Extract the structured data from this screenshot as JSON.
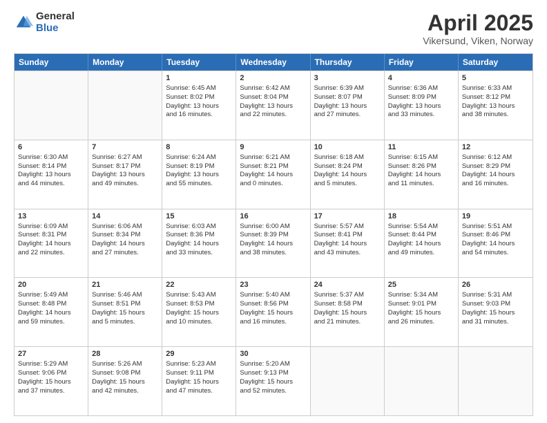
{
  "logo": {
    "general": "General",
    "blue": "Blue"
  },
  "title": "April 2025",
  "subtitle": "Vikersund, Viken, Norway",
  "weekdays": [
    "Sunday",
    "Monday",
    "Tuesday",
    "Wednesday",
    "Thursday",
    "Friday",
    "Saturday"
  ],
  "weeks": [
    [
      {
        "day": "",
        "info": ""
      },
      {
        "day": "",
        "info": ""
      },
      {
        "day": "1",
        "info": "Sunrise: 6:45 AM\nSunset: 8:02 PM\nDaylight: 13 hours\nand 16 minutes."
      },
      {
        "day": "2",
        "info": "Sunrise: 6:42 AM\nSunset: 8:04 PM\nDaylight: 13 hours\nand 22 minutes."
      },
      {
        "day": "3",
        "info": "Sunrise: 6:39 AM\nSunset: 8:07 PM\nDaylight: 13 hours\nand 27 minutes."
      },
      {
        "day": "4",
        "info": "Sunrise: 6:36 AM\nSunset: 8:09 PM\nDaylight: 13 hours\nand 33 minutes."
      },
      {
        "day": "5",
        "info": "Sunrise: 6:33 AM\nSunset: 8:12 PM\nDaylight: 13 hours\nand 38 minutes."
      }
    ],
    [
      {
        "day": "6",
        "info": "Sunrise: 6:30 AM\nSunset: 8:14 PM\nDaylight: 13 hours\nand 44 minutes."
      },
      {
        "day": "7",
        "info": "Sunrise: 6:27 AM\nSunset: 8:17 PM\nDaylight: 13 hours\nand 49 minutes."
      },
      {
        "day": "8",
        "info": "Sunrise: 6:24 AM\nSunset: 8:19 PM\nDaylight: 13 hours\nand 55 minutes."
      },
      {
        "day": "9",
        "info": "Sunrise: 6:21 AM\nSunset: 8:21 PM\nDaylight: 14 hours\nand 0 minutes."
      },
      {
        "day": "10",
        "info": "Sunrise: 6:18 AM\nSunset: 8:24 PM\nDaylight: 14 hours\nand 5 minutes."
      },
      {
        "day": "11",
        "info": "Sunrise: 6:15 AM\nSunset: 8:26 PM\nDaylight: 14 hours\nand 11 minutes."
      },
      {
        "day": "12",
        "info": "Sunrise: 6:12 AM\nSunset: 8:29 PM\nDaylight: 14 hours\nand 16 minutes."
      }
    ],
    [
      {
        "day": "13",
        "info": "Sunrise: 6:09 AM\nSunset: 8:31 PM\nDaylight: 14 hours\nand 22 minutes."
      },
      {
        "day": "14",
        "info": "Sunrise: 6:06 AM\nSunset: 8:34 PM\nDaylight: 14 hours\nand 27 minutes."
      },
      {
        "day": "15",
        "info": "Sunrise: 6:03 AM\nSunset: 8:36 PM\nDaylight: 14 hours\nand 33 minutes."
      },
      {
        "day": "16",
        "info": "Sunrise: 6:00 AM\nSunset: 8:39 PM\nDaylight: 14 hours\nand 38 minutes."
      },
      {
        "day": "17",
        "info": "Sunrise: 5:57 AM\nSunset: 8:41 PM\nDaylight: 14 hours\nand 43 minutes."
      },
      {
        "day": "18",
        "info": "Sunrise: 5:54 AM\nSunset: 8:44 PM\nDaylight: 14 hours\nand 49 minutes."
      },
      {
        "day": "19",
        "info": "Sunrise: 5:51 AM\nSunset: 8:46 PM\nDaylight: 14 hours\nand 54 minutes."
      }
    ],
    [
      {
        "day": "20",
        "info": "Sunrise: 5:49 AM\nSunset: 8:48 PM\nDaylight: 14 hours\nand 59 minutes."
      },
      {
        "day": "21",
        "info": "Sunrise: 5:46 AM\nSunset: 8:51 PM\nDaylight: 15 hours\nand 5 minutes."
      },
      {
        "day": "22",
        "info": "Sunrise: 5:43 AM\nSunset: 8:53 PM\nDaylight: 15 hours\nand 10 minutes."
      },
      {
        "day": "23",
        "info": "Sunrise: 5:40 AM\nSunset: 8:56 PM\nDaylight: 15 hours\nand 16 minutes."
      },
      {
        "day": "24",
        "info": "Sunrise: 5:37 AM\nSunset: 8:58 PM\nDaylight: 15 hours\nand 21 minutes."
      },
      {
        "day": "25",
        "info": "Sunrise: 5:34 AM\nSunset: 9:01 PM\nDaylight: 15 hours\nand 26 minutes."
      },
      {
        "day": "26",
        "info": "Sunrise: 5:31 AM\nSunset: 9:03 PM\nDaylight: 15 hours\nand 31 minutes."
      }
    ],
    [
      {
        "day": "27",
        "info": "Sunrise: 5:29 AM\nSunset: 9:06 PM\nDaylight: 15 hours\nand 37 minutes."
      },
      {
        "day": "28",
        "info": "Sunrise: 5:26 AM\nSunset: 9:08 PM\nDaylight: 15 hours\nand 42 minutes."
      },
      {
        "day": "29",
        "info": "Sunrise: 5:23 AM\nSunset: 9:11 PM\nDaylight: 15 hours\nand 47 minutes."
      },
      {
        "day": "30",
        "info": "Sunrise: 5:20 AM\nSunset: 9:13 PM\nDaylight: 15 hours\nand 52 minutes."
      },
      {
        "day": "",
        "info": ""
      },
      {
        "day": "",
        "info": ""
      },
      {
        "day": "",
        "info": ""
      }
    ]
  ]
}
